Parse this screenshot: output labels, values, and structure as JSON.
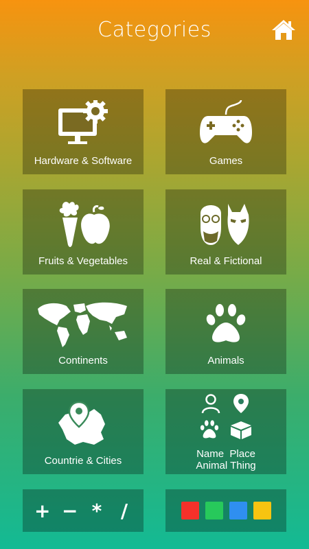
{
  "header": {
    "title": "Categories"
  },
  "tiles": [
    {
      "label": "Hardware & Software"
    },
    {
      "label": "Games"
    },
    {
      "label": "Fruits & Vegetables"
    },
    {
      "label": "Real & Fictional"
    },
    {
      "label": "Continents"
    },
    {
      "label": "Animals"
    },
    {
      "label": "Countrie & Cities"
    },
    {
      "label_line1": "Name  Place",
      "label_line2": "Animal Thing"
    }
  ],
  "math": {
    "ops": [
      "+",
      "−",
      "*",
      "/"
    ]
  },
  "colors": {
    "swatches": [
      "#f5312a",
      "#27c95b",
      "#2f8ff0",
      "#f7c411"
    ]
  }
}
